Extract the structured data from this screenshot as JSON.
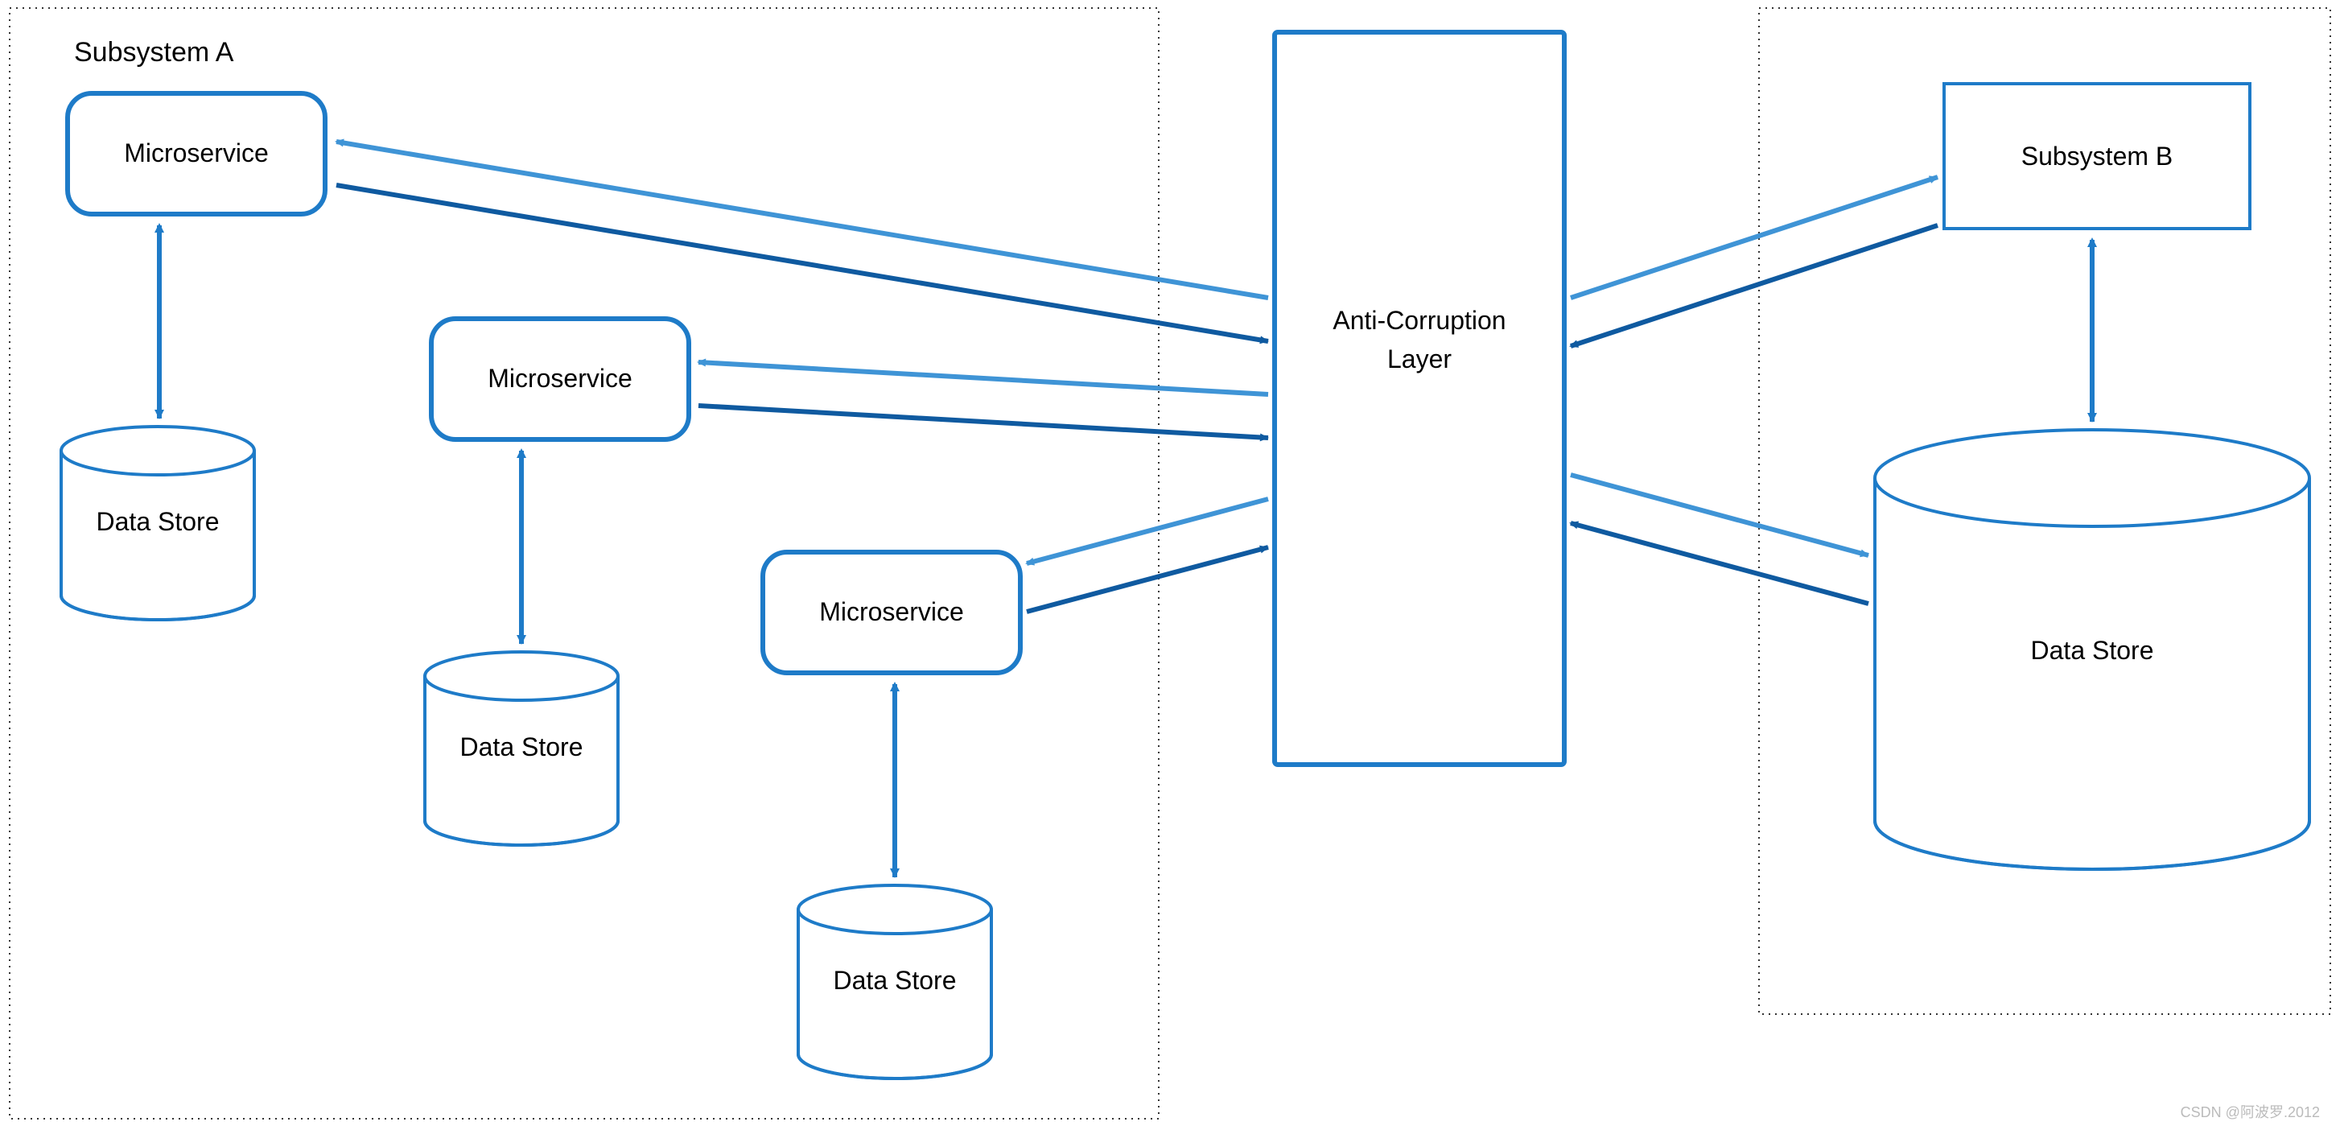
{
  "subsystemA": {
    "title": "Subsystem A"
  },
  "subsystemB": {
    "title": "Subsystem B"
  },
  "microservices": [
    {
      "label": "Microservice"
    },
    {
      "label": "Microservice"
    },
    {
      "label": "Microservice"
    }
  ],
  "datastores": [
    {
      "label": "Data Store"
    },
    {
      "label": "Data Store"
    },
    {
      "label": "Data Store"
    },
    {
      "label": "Data Store"
    }
  ],
  "acl": {
    "line1": "Anti-Corruption",
    "line2": "Layer"
  },
  "watermark": "CSDN @阿波罗.2012",
  "colors": {
    "primary": "#1E7BC8",
    "light": "#3F94D6",
    "dark": "#0F5AA0"
  },
  "diagram_structure": {
    "type": "architecture-diagram",
    "description": "Anti-Corruption Layer pattern between Subsystem A (3 microservices each with a data store) and Subsystem B (one service with a data store). Bidirectional arrows connect each microservice to the ACL, and the ACL to Subsystem B and its data store.",
    "nodes": [
      {
        "id": "subA",
        "type": "boundary",
        "label": "Subsystem A"
      },
      {
        "id": "ms1",
        "type": "microservice",
        "label": "Microservice",
        "parent": "subA"
      },
      {
        "id": "ds1",
        "type": "datastore",
        "label": "Data Store",
        "parent": "subA"
      },
      {
        "id": "ms2",
        "type": "microservice",
        "label": "Microservice",
        "parent": "subA"
      },
      {
        "id": "ds2",
        "type": "datastore",
        "label": "Data Store",
        "parent": "subA"
      },
      {
        "id": "ms3",
        "type": "microservice",
        "label": "Microservice",
        "parent": "subA"
      },
      {
        "id": "ds3",
        "type": "datastore",
        "label": "Data Store",
        "parent": "subA"
      },
      {
        "id": "acl",
        "type": "layer",
        "label": "Anti-Corruption Layer"
      },
      {
        "id": "subBBoundary",
        "type": "boundary",
        "label": ""
      },
      {
        "id": "subB",
        "type": "subsystem",
        "label": "Subsystem B",
        "parent": "subBBoundary"
      },
      {
        "id": "dsB",
        "type": "datastore",
        "label": "Data Store",
        "parent": "subBBoundary"
      }
    ],
    "edges": [
      {
        "from": "ms1",
        "to": "ds1",
        "bidir": true
      },
      {
        "from": "ms2",
        "to": "ds2",
        "bidir": true
      },
      {
        "from": "ms3",
        "to": "ds3",
        "bidir": true
      },
      {
        "from": "ms1",
        "to": "acl",
        "bidir": true
      },
      {
        "from": "ms2",
        "to": "acl",
        "bidir": true
      },
      {
        "from": "ms3",
        "to": "acl",
        "bidir": true
      },
      {
        "from": "acl",
        "to": "subB",
        "bidir": true
      },
      {
        "from": "acl",
        "to": "dsB",
        "bidir": true
      },
      {
        "from": "subB",
        "to": "dsB",
        "bidir": true
      }
    ]
  }
}
